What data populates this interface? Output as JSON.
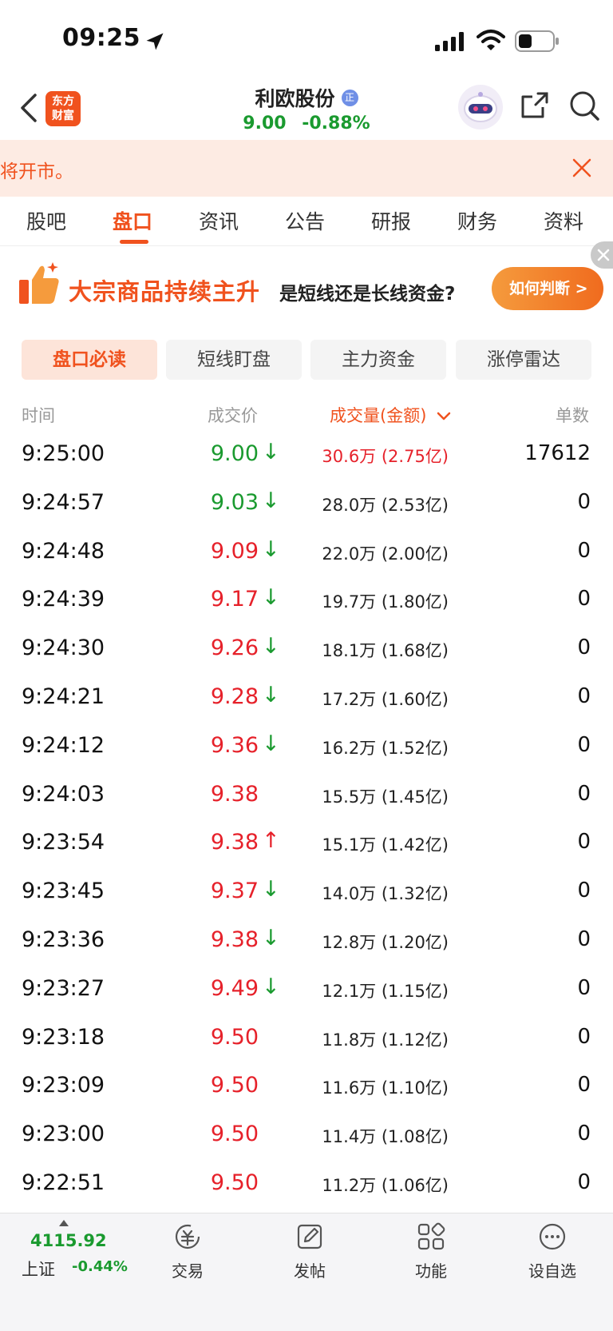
{
  "status_bar": {
    "time": "09:25"
  },
  "header": {
    "logo_line1": "东方",
    "logo_line2": "财富",
    "stock_name": "利欧股份",
    "badge": "正",
    "price": "9.00",
    "change_pct": "-0.88%"
  },
  "notice": {
    "text": "将开市。"
  },
  "tabs": [
    {
      "label": "股吧"
    },
    {
      "label": "盘口"
    },
    {
      "label": "资讯"
    },
    {
      "label": "公告"
    },
    {
      "label": "研报"
    },
    {
      "label": "财务"
    },
    {
      "label": "资料"
    }
  ],
  "banner": {
    "title": "大宗商品持续主升",
    "subtitle": "是短线还是长线资金?",
    "button": "如何判断 >"
  },
  "subtabs": [
    {
      "label": "盘口必读"
    },
    {
      "label": "短线盯盘"
    },
    {
      "label": "主力资金"
    },
    {
      "label": "涨停雷达"
    }
  ],
  "table": {
    "headers": {
      "time": "时间",
      "price": "成交价",
      "volume": "成交量(金额)",
      "count": "单数"
    },
    "rows": [
      {
        "time": "9:25:00",
        "price": "9.00",
        "price_color": "green",
        "arrow": "↓",
        "arrow_color": "green",
        "volume": "30.6万 (2.75亿)",
        "volume_color": "red",
        "count": "17612"
      },
      {
        "time": "9:24:57",
        "price": "9.03",
        "price_color": "green",
        "arrow": "↓",
        "arrow_color": "green",
        "volume": "28.0万 (2.53亿)",
        "volume_color": "black",
        "count": "0"
      },
      {
        "time": "9:24:48",
        "price": "9.09",
        "price_color": "red",
        "arrow": "↓",
        "arrow_color": "green",
        "volume": "22.0万 (2.00亿)",
        "volume_color": "black",
        "count": "0"
      },
      {
        "time": "9:24:39",
        "price": "9.17",
        "price_color": "red",
        "arrow": "↓",
        "arrow_color": "green",
        "volume": "19.7万 (1.80亿)",
        "volume_color": "black",
        "count": "0"
      },
      {
        "time": "9:24:30",
        "price": "9.26",
        "price_color": "red",
        "arrow": "↓",
        "arrow_color": "green",
        "volume": "18.1万 (1.68亿)",
        "volume_color": "black",
        "count": "0"
      },
      {
        "time": "9:24:21",
        "price": "9.28",
        "price_color": "red",
        "arrow": "↓",
        "arrow_color": "green",
        "volume": "17.2万 (1.60亿)",
        "volume_color": "black",
        "count": "0"
      },
      {
        "time": "9:24:12",
        "price": "9.36",
        "price_color": "red",
        "arrow": "↓",
        "arrow_color": "green",
        "volume": "16.2万 (1.52亿)",
        "volume_color": "black",
        "count": "0"
      },
      {
        "time": "9:24:03",
        "price": "9.38",
        "price_color": "red",
        "arrow": "",
        "arrow_color": "green",
        "volume": "15.5万 (1.45亿)",
        "volume_color": "black",
        "count": "0"
      },
      {
        "time": "9:23:54",
        "price": "9.38",
        "price_color": "red",
        "arrow": "↑",
        "arrow_color": "red",
        "volume": "15.1万 (1.42亿)",
        "volume_color": "black",
        "count": "0"
      },
      {
        "time": "9:23:45",
        "price": "9.37",
        "price_color": "red",
        "arrow": "↓",
        "arrow_color": "green",
        "volume": "14.0万 (1.32亿)",
        "volume_color": "black",
        "count": "0"
      },
      {
        "time": "9:23:36",
        "price": "9.38",
        "price_color": "red",
        "arrow": "↓",
        "arrow_color": "green",
        "volume": "12.8万 (1.20亿)",
        "volume_color": "black",
        "count": "0"
      },
      {
        "time": "9:23:27",
        "price": "9.49",
        "price_color": "red",
        "arrow": "↓",
        "arrow_color": "green",
        "volume": "12.1万 (1.15亿)",
        "volume_color": "black",
        "count": "0"
      },
      {
        "time": "9:23:18",
        "price": "9.50",
        "price_color": "red",
        "arrow": "",
        "arrow_color": "green",
        "volume": "11.8万 (1.12亿)",
        "volume_color": "black",
        "count": "0"
      },
      {
        "time": "9:23:09",
        "price": "9.50",
        "price_color": "red",
        "arrow": "",
        "arrow_color": "green",
        "volume": "11.6万 (1.10亿)",
        "volume_color": "black",
        "count": "0"
      },
      {
        "time": "9:23:00",
        "price": "9.50",
        "price_color": "red",
        "arrow": "",
        "arrow_color": "green",
        "volume": "11.4万 (1.08亿)",
        "volume_color": "black",
        "count": "0"
      },
      {
        "time": "9:22:51",
        "price": "9.50",
        "price_color": "red",
        "arrow": "",
        "arrow_color": "green",
        "volume": "11.2万 (1.06亿)",
        "volume_color": "black",
        "count": "0"
      }
    ]
  },
  "bottom_bar": {
    "index_value": "4115.92",
    "index_name": "上证",
    "index_change": "-0.44%",
    "nav": [
      {
        "label": "交易",
        "icon": "yuan-cycle-icon"
      },
      {
        "label": "发帖",
        "icon": "edit-icon"
      },
      {
        "label": "功能",
        "icon": "grid-icon"
      },
      {
        "label": "设自选",
        "icon": "more-icon"
      }
    ]
  },
  "colors": {
    "accent": "#f0521e",
    "up_red": "#e6212a",
    "down_green": "#1a9a2f"
  }
}
